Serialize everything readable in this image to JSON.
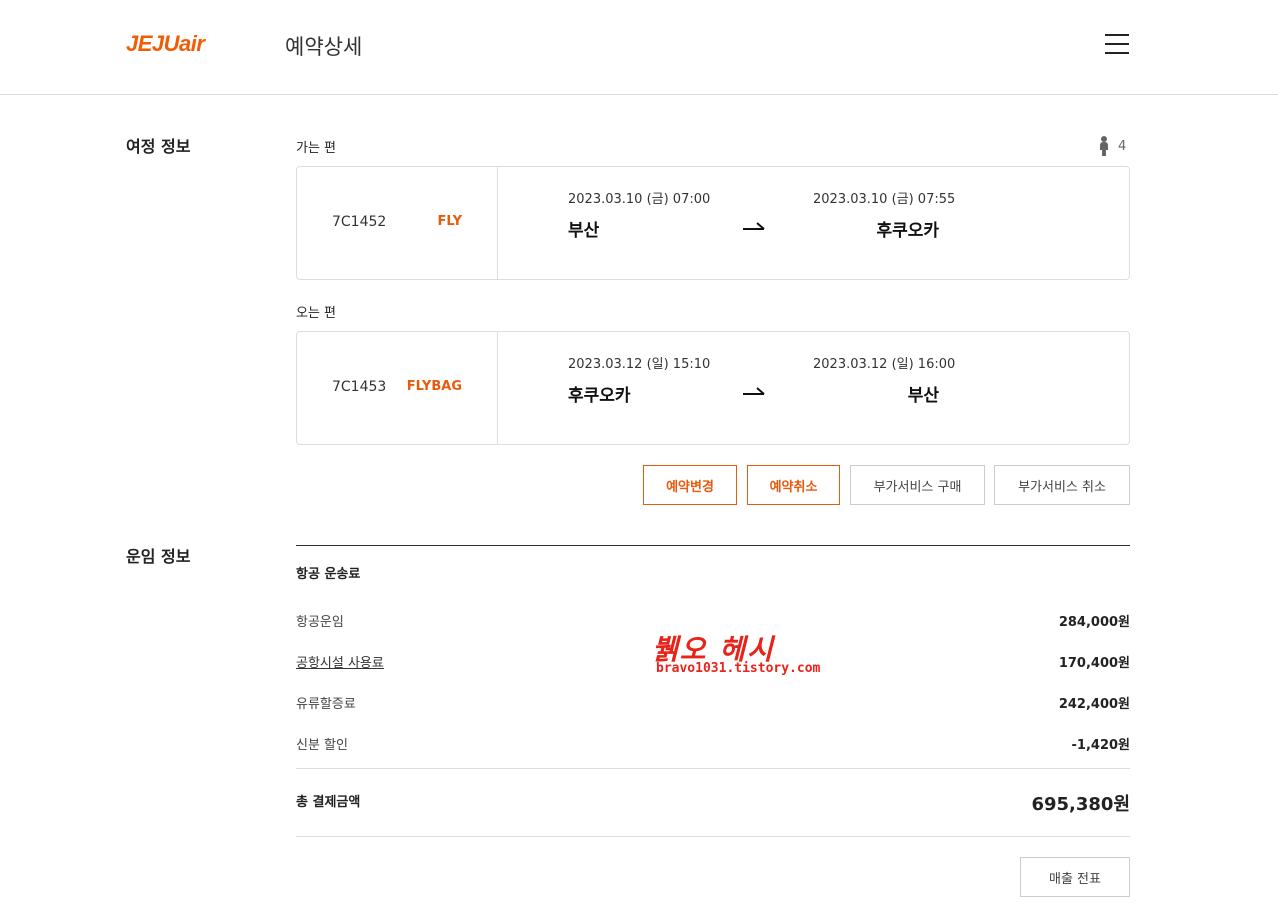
{
  "header": {
    "logo": "JEJUair",
    "title": "예약상세",
    "menu_icon": "hamburger-menu-icon"
  },
  "itinerary": {
    "section_title": "여정 정보",
    "passenger_count": "4",
    "passenger_icon": "person-icon",
    "outbound": {
      "label": "가는 편",
      "flight_no": "7C1452",
      "fare_type": "FLY",
      "dep_time": "2023.03.10 (금) 07:00",
      "arr_time": "2023.03.10 (금) 07:55",
      "dep_city": "부산",
      "arr_city": "후쿠오카"
    },
    "inbound": {
      "label": "오는 편",
      "flight_no": "7C1453",
      "fare_type": "FLYBAG",
      "dep_time": "2023.03.12 (일) 15:10",
      "arr_time": "2023.03.12 (일) 16:00",
      "dep_city": "후쿠오카",
      "arr_city": "부산"
    },
    "buttons": {
      "change": "예약변경",
      "cancel": "예약취소",
      "buy_service": "부가서비스 구매",
      "cancel_service": "부가서비스 취소"
    }
  },
  "fare": {
    "section_title": "운임 정보",
    "group_title": "항공 운송료",
    "rows": [
      {
        "label": "항공운임",
        "amount": "284,000원"
      },
      {
        "label": "공항시설 사용료",
        "amount": "170,400원"
      },
      {
        "label": "유류할증료",
        "amount": "242,400원"
      },
      {
        "label": "신분 할인",
        "amount": "-1,420원"
      }
    ],
    "total_label": "총 결제금액",
    "total_amount": "695,380원",
    "receipt_button": "매출 전표"
  },
  "watermark": {
    "script": "뷁오 헤시",
    "url": "bravo1031.tistory.com"
  },
  "colors": {
    "accent": "#e85a0c",
    "logo": "#f25c05",
    "watermark": "#e8231a"
  }
}
